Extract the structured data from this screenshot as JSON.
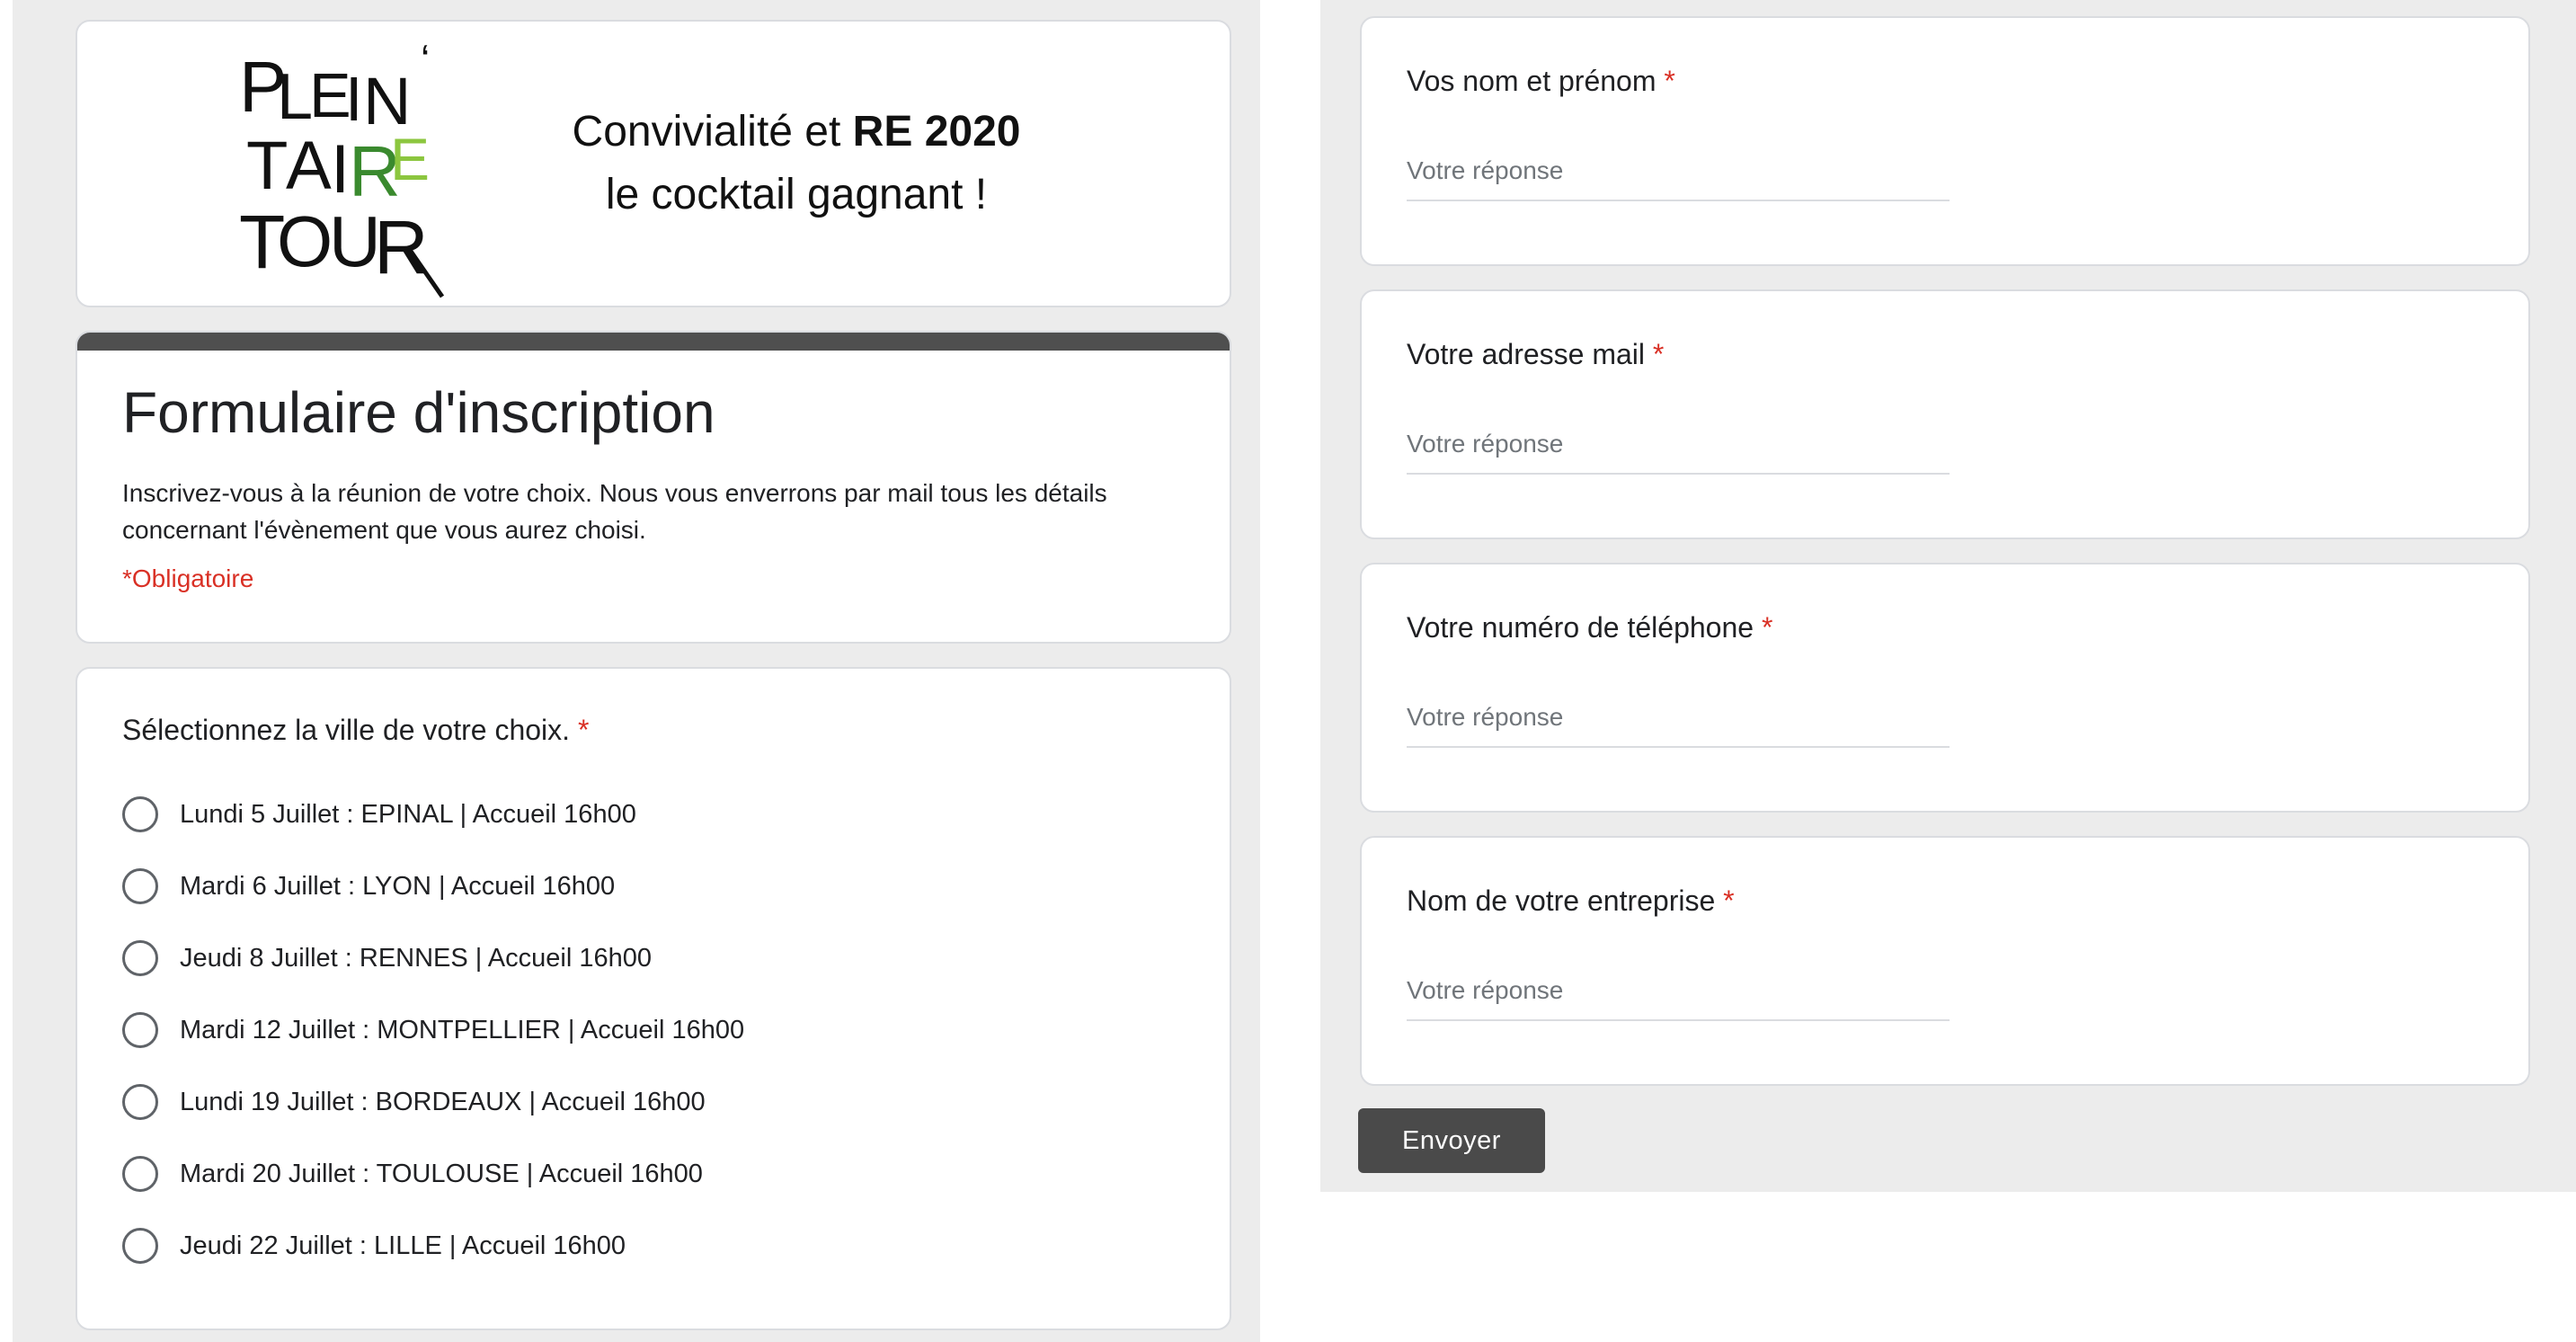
{
  "header": {
    "logo_lines": [
      "PLEIN",
      "AIRE",
      "TOUR"
    ],
    "logo_letters": {
      "line1": [
        "P",
        "L",
        "E",
        "I",
        "N",
        "‘"
      ],
      "line2": [
        "T",
        "A",
        "I",
        "R",
        "E"
      ],
      "line3": [
        "T",
        "O",
        "U",
        "R"
      ]
    },
    "tagline_line1_normal": "Convivialité et ",
    "tagline_line1_bold": "RE 2020",
    "tagline_line2": "le cocktail gagnant !"
  },
  "form": {
    "title": "Formulaire d'inscription",
    "description": "Inscrivez-vous à la réunion de votre choix. Nous vous enverrons par mail tous les détails concernant l'évènement que vous aurez choisi.",
    "required_note": "*Obligatoire"
  },
  "city_question": {
    "label": "Sélectionnez la ville de votre choix.",
    "required_mark": "*",
    "options": [
      "Lundi 5 Juillet : EPINAL | Accueil 16h00",
      "Mardi 6 Juillet : LYON | Accueil 16h00",
      "Jeudi 8 Juillet : RENNES | Accueil 16h00",
      "Mardi 12 Juillet : MONTPELLIER | Accueil 16h00",
      "Lundi 19 Juillet : BORDEAUX | Accueil 16h00",
      "Mardi 20 Juillet : TOULOUSE | Accueil 16h00",
      "Jeudi 22 Juillet : LILLE | Accueil 16h00"
    ]
  },
  "fields": [
    {
      "label": "Vos nom et prénom",
      "required_mark": "*",
      "placeholder": "Votre réponse"
    },
    {
      "label": "Votre adresse mail",
      "required_mark": "*",
      "placeholder": "Votre réponse"
    },
    {
      "label": "Votre numéro de téléphone",
      "required_mark": "*",
      "placeholder": "Votre réponse"
    },
    {
      "label": "Nom de votre entreprise",
      "required_mark": "*",
      "placeholder": "Votre réponse"
    }
  ],
  "submit_label": "Envoyer",
  "colors": {
    "accent_bar": "#4f4f4f",
    "required": "#d93025",
    "logo_green_dark": "#3a8a2e",
    "logo_green_light": "#8cc63f",
    "button": "#4a4a4a"
  }
}
